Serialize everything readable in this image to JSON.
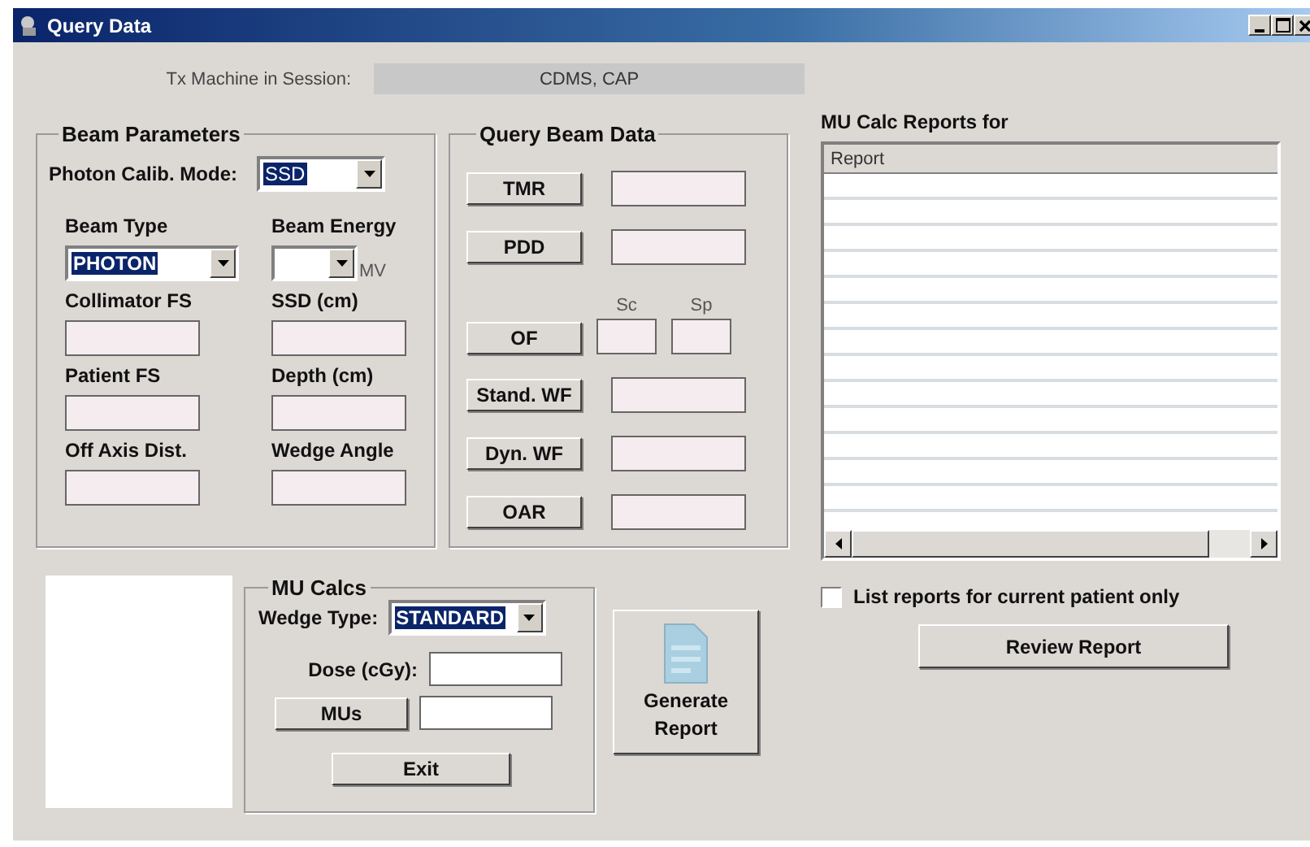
{
  "window": {
    "title": "Query Data"
  },
  "session": {
    "label": "Tx Machine in Session:",
    "value": "CDMS, CAP"
  },
  "beam_parameters": {
    "title": "Beam Parameters",
    "calib_mode": {
      "label": "Photon Calib. Mode:",
      "value": "SSD"
    },
    "fields": [
      {
        "label": "Beam Type",
        "kind": "dropdown",
        "value": "PHOTON"
      },
      {
        "label": "Beam Energy",
        "kind": "dropdown",
        "unit": "MV"
      },
      {
        "label": "Collimator FS",
        "kind": "text"
      },
      {
        "label": "SSD (cm)",
        "kind": "text"
      },
      {
        "label": "Patient FS",
        "kind": "text"
      },
      {
        "label": "Depth (cm)",
        "kind": "text"
      },
      {
        "label": "Off Axis Dist.",
        "kind": "text"
      },
      {
        "label": "Wedge Angle",
        "kind": "text"
      }
    ]
  },
  "query_beam_data": {
    "title": "Query Beam Data",
    "rows": [
      {
        "button": "TMR",
        "kind": "single"
      },
      {
        "button": "PDD",
        "kind": "single"
      },
      {
        "button": "OF",
        "kind": "pair",
        "labels": [
          "Sc",
          "Sp"
        ]
      },
      {
        "button": "Stand. WF",
        "kind": "single"
      },
      {
        "button": "Dyn. WF",
        "kind": "single"
      },
      {
        "button": "OAR",
        "kind": "single"
      }
    ]
  },
  "reports": {
    "title": "MU Calc Reports for",
    "columns": [
      "Report"
    ],
    "checkbox": {
      "label": "List reports for current patient only",
      "checked": false
    },
    "button": "Review Report"
  },
  "mu_calcs": {
    "title": "MU Calcs",
    "wedge_type": {
      "label": "Wedge Type:",
      "value": "STANDARD"
    },
    "dose_label": "Dose (cGy):",
    "mus_button": "MUs",
    "exit_button": "Exit"
  },
  "generate_button": "Generate Report"
}
